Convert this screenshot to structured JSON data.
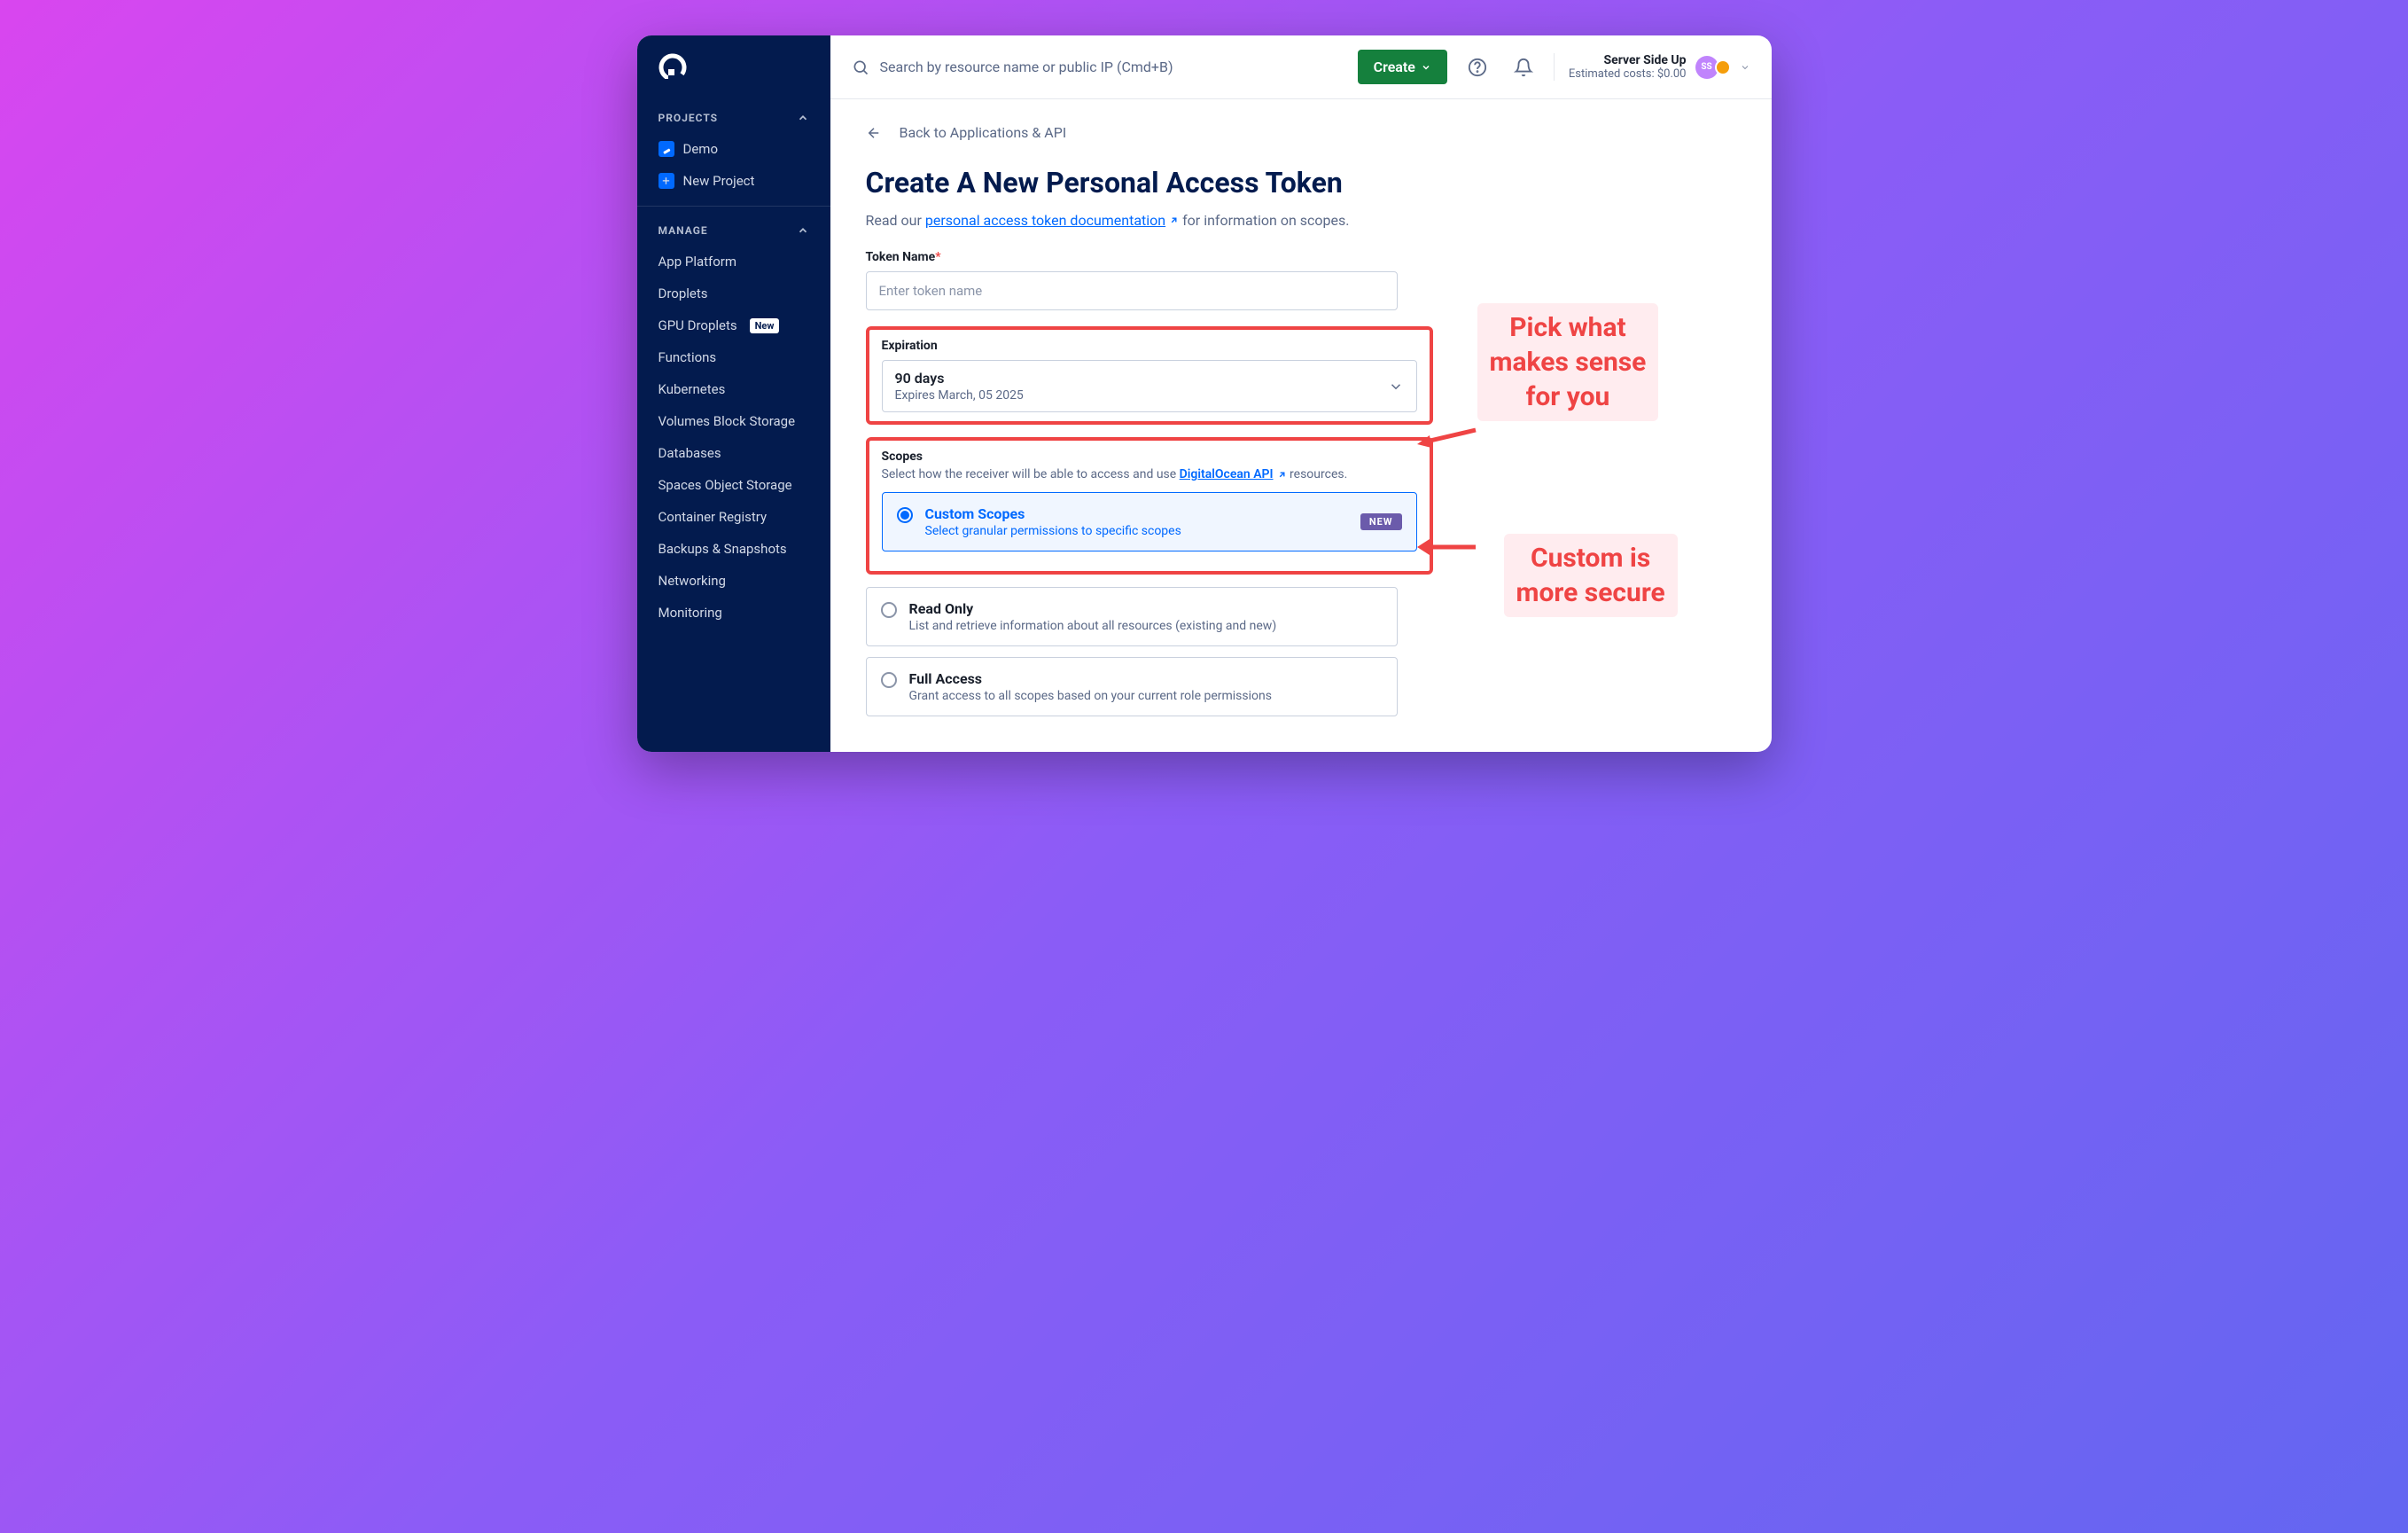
{
  "sidebar": {
    "sections": {
      "projects": {
        "label": "PROJECTS"
      },
      "manage": {
        "label": "MANAGE"
      }
    },
    "projectItems": [
      {
        "label": "Demo"
      },
      {
        "label": "New Project"
      }
    ],
    "manageItems": [
      {
        "label": "App Platform"
      },
      {
        "label": "Droplets"
      },
      {
        "label": "GPU Droplets",
        "badge": "New"
      },
      {
        "label": "Functions"
      },
      {
        "label": "Kubernetes"
      },
      {
        "label": "Volumes Block Storage"
      },
      {
        "label": "Databases"
      },
      {
        "label": "Spaces Object Storage"
      },
      {
        "label": "Container Registry"
      },
      {
        "label": "Backups & Snapshots"
      },
      {
        "label": "Networking"
      },
      {
        "label": "Monitoring"
      }
    ]
  },
  "topbar": {
    "searchPlaceholder": "Search by resource name or public IP (Cmd+B)",
    "createLabel": "Create",
    "userName": "Server Side Up",
    "estimatedCosts": "Estimated costs: $0.00",
    "avatarInitials": "SS"
  },
  "page": {
    "backLink": "Back to Applications & API",
    "title": "Create A New Personal Access Token",
    "subtitlePre": "Read our ",
    "subtitleLink": "personal access token documentation",
    "subtitlePost": " for information on scopes.",
    "tokenNameLabel": "Token Name",
    "tokenNamePlaceholder": "Enter token name",
    "expirationLabel": "Expiration",
    "expirationValue": "90 days",
    "expirationSub": "Expires March, 05 2025",
    "scopesLabel": "Scopes",
    "scopesSubPre": "Select how the receiver will be able to access and use ",
    "scopesLink": "DigitalOcean API",
    "scopesSubPost": " resources.",
    "scopes": [
      {
        "title": "Custom Scopes",
        "desc": "Select granular permissions to specific scopes",
        "selected": true,
        "badge": "NEW"
      },
      {
        "title": "Read Only",
        "desc": "List and retrieve information about all resources (existing and new)",
        "selected": false
      },
      {
        "title": "Full Access",
        "desc": "Grant access to all scopes based on your current role permissions",
        "selected": false
      }
    ]
  },
  "annotations": {
    "expiration": "Pick what\nmakes sense\nfor you",
    "scopes": "Custom is\nmore secure"
  }
}
